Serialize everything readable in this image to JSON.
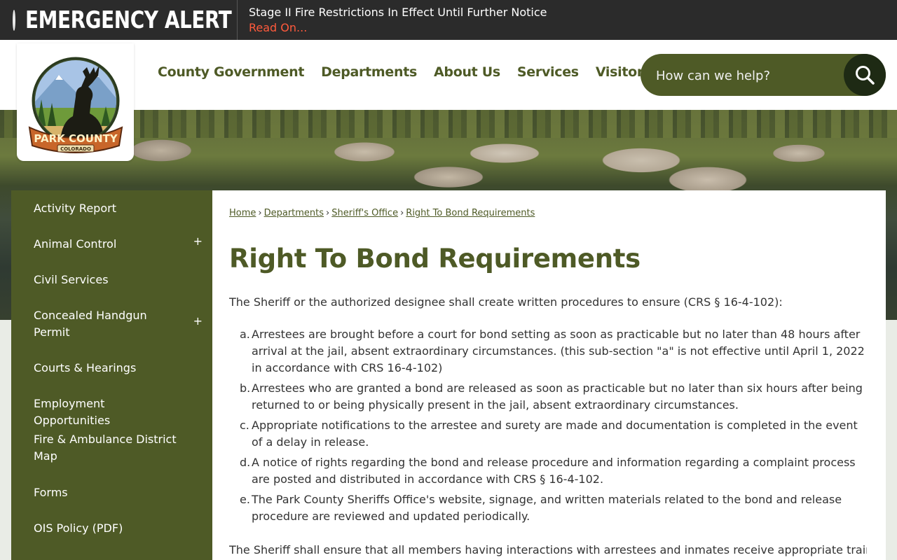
{
  "alert": {
    "title": "EMERGENCY ALERT",
    "message": "Stage II Fire Restrictions In Effect Until Further Notice",
    "read_on": "Read On..."
  },
  "logo": {
    "name": "PARK COUNTY",
    "state": "COLORADO"
  },
  "nav": {
    "items": [
      "County Government",
      "Departments",
      "About Us",
      "Services",
      "Visitors"
    ]
  },
  "search": {
    "placeholder": "How can we help?"
  },
  "sidebar": {
    "items": [
      {
        "label": "Activity Report",
        "expandable": false
      },
      {
        "label": "Animal Control",
        "expandable": true
      },
      {
        "label": "Civil Services",
        "expandable": false
      },
      {
        "label": "Concealed Handgun Permit",
        "expandable": true
      },
      {
        "label": "Courts & Hearings",
        "expandable": false
      },
      {
        "label": "Employment Opportunities",
        "expandable": false
      },
      {
        "label": "Fire & Ambulance District Map",
        "expandable": false
      },
      {
        "label": "Forms",
        "expandable": false
      },
      {
        "label": "OIS Policy (PDF)",
        "expandable": false
      }
    ],
    "expand_symbol": "+"
  },
  "breadcrumb": {
    "items": [
      "Home",
      "Departments",
      "Sheriff's Office",
      "Right To Bond Requirements"
    ],
    "separator": "›"
  },
  "main": {
    "title": "Right To Bond Requirements",
    "intro": "The Sheriff or the authorized designee shall create written procedures to ensure (CRS § 16-4-102):",
    "list": [
      {
        "marker": "a.",
        "text": "Arrestees are brought before a court for bond setting as soon as practicable but no later than 48 hours after arrival at the jail, absent extraordinary circumstances. (this sub-section \"a\" is not effective until April 1, 2022 in accordance with CRS 16-4-102)"
      },
      {
        "marker": "b.",
        "text": "Arrestees who are granted a bond are released as soon as practicable but no later than six hours after being returned to or being physically present in the jail, absent extraordinary circumstances."
      },
      {
        "marker": "c.",
        "text": "Appropriate notifications to the arrestee and surety are made and documentation is completed in the event of a delay in release."
      },
      {
        "marker": "d.",
        "text": "A notice of rights regarding the bond and release procedure and information regarding a complaint process are posted and distributed in accordance with CRS § 16-4-102."
      },
      {
        "marker": "e.",
        "text": "The Park County Sheriffs Office's website, signage, and written materials related to the bond and release procedure are reviewed and updated periodically."
      }
    ],
    "closing": "The Sheriff shall ensure that all members having interactions with arrestees and inmates receive appropriate training"
  },
  "colors": {
    "brand_green": "#4e5a26",
    "alert_red": "#ff5a3c",
    "search_button": "#1e2a14"
  }
}
